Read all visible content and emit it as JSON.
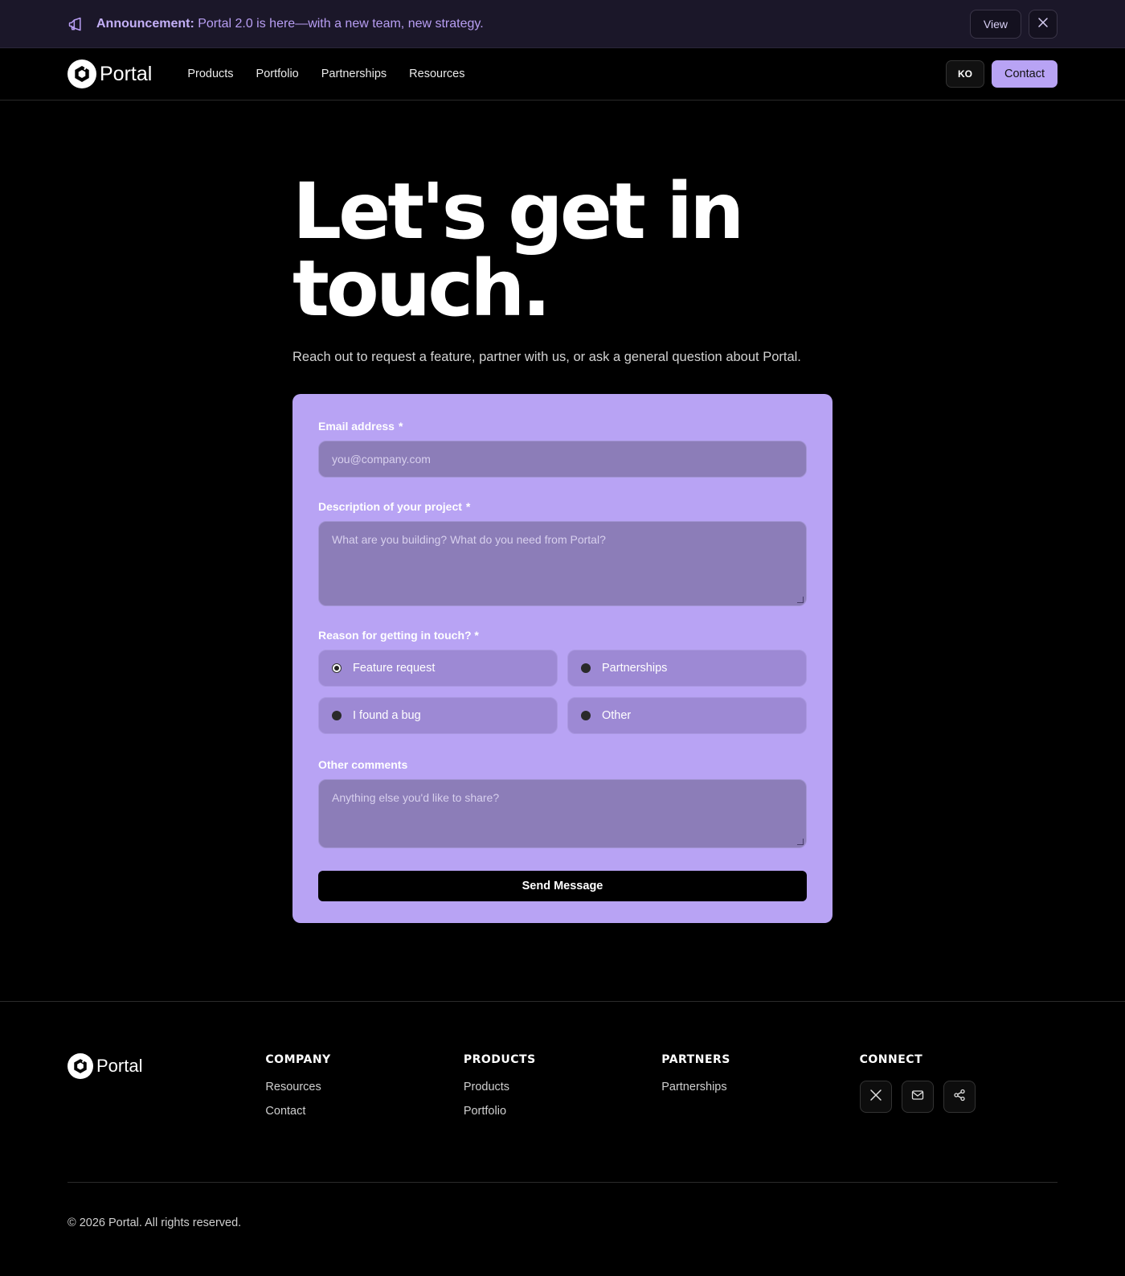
{
  "announcement": {
    "prefix": "Announcement:",
    "message": "Portal 2.0 is here—with a new team, new strategy.",
    "view_label": "View"
  },
  "nav": {
    "brand": "Portal",
    "links": [
      "Products",
      "Portfolio",
      "Partnerships",
      "Resources"
    ],
    "lang_label": "KO",
    "contact_label": "Contact"
  },
  "hero": {
    "title_line1": "Let's get in",
    "title_line2": "touch.",
    "subtitle": "Reach out to request a feature, partner with us, or ask a general question about Portal."
  },
  "form": {
    "email": {
      "label": "Email address",
      "required": "*",
      "placeholder": "you@company.com"
    },
    "description": {
      "label": "Description of your project",
      "required": "*",
      "placeholder": "What are you building? What do you need from Portal?"
    },
    "reason": {
      "label": "Reason for getting in touch? *",
      "options": [
        "Feature request",
        "Partnerships",
        "I found a bug",
        "Other"
      ],
      "selected": "Feature request"
    },
    "comments": {
      "label": "Other comments",
      "placeholder": "Anything else you'd like to share?"
    },
    "submit_label": "Send Message"
  },
  "footer": {
    "brand": "Portal",
    "columns": [
      {
        "title": "COMPANY",
        "links": [
          "Resources",
          "Contact"
        ]
      },
      {
        "title": "PRODUCTS",
        "links": [
          "Products",
          "Portfolio"
        ]
      },
      {
        "title": "PARTNERS",
        "links": [
          "Partnerships"
        ]
      },
      {
        "title": "CONNECT",
        "icons": [
          "x-icon",
          "mail-icon",
          "share-icon"
        ]
      }
    ],
    "copyright": "© 2026 Portal. All rights reserved."
  },
  "colors": {
    "accent": "#b8a3f4",
    "announcement_bg": "#1b1729",
    "background": "#000000"
  }
}
